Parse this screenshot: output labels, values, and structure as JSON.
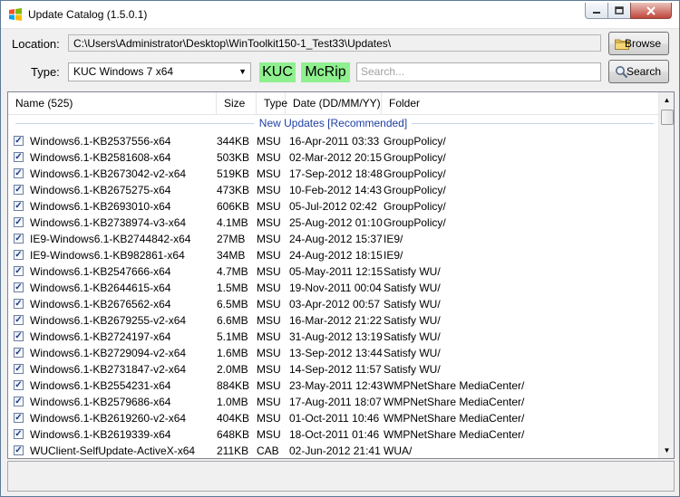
{
  "window": {
    "title": "Update Catalog (1.5.0.1)"
  },
  "location": {
    "label": "Location:",
    "path": "C:\\Users\\Administrator\\Desktop\\WinToolkit150-1_Test33\\Updates\\"
  },
  "browse_label": "Browse",
  "type": {
    "label": "Type:",
    "selected": "KUC Windows 7 x64"
  },
  "tags": {
    "kuc": "KUC",
    "mcrip": "McRip"
  },
  "search": {
    "placeholder": "Search...",
    "button_label": "Search"
  },
  "table": {
    "columns": [
      "Name (525)",
      "Size",
      "Type",
      "Date (DD/MM/YY)",
      "Folder"
    ],
    "group_title": "New Updates [Recommended]",
    "rows": [
      {
        "name": "Windows6.1-KB2537556-x64",
        "size": "344KB",
        "type": "MSU",
        "date": "16-Apr-2011 03:33",
        "folder": "GroupPolicy/"
      },
      {
        "name": "Windows6.1-KB2581608-x64",
        "size": "503KB",
        "type": "MSU",
        "date": "02-Mar-2012 20:15",
        "folder": "GroupPolicy/"
      },
      {
        "name": "Windows6.1-KB2673042-v2-x64",
        "size": "519KB",
        "type": "MSU",
        "date": "17-Sep-2012 18:48",
        "folder": "GroupPolicy/"
      },
      {
        "name": "Windows6.1-KB2675275-x64",
        "size": "473KB",
        "type": "MSU",
        "date": "10-Feb-2012 14:43",
        "folder": "GroupPolicy/"
      },
      {
        "name": "Windows6.1-KB2693010-x64",
        "size": "606KB",
        "type": "MSU",
        "date": "05-Jul-2012 02:42",
        "folder": "GroupPolicy/"
      },
      {
        "name": "Windows6.1-KB2738974-v3-x64",
        "size": "4.1MB",
        "type": "MSU",
        "date": "25-Aug-2012 01:10",
        "folder": "GroupPolicy/"
      },
      {
        "name": "IE9-Windows6.1-KB2744842-x64",
        "size": "27MB",
        "type": "MSU",
        "date": "24-Aug-2012 15:37",
        "folder": "IE9/"
      },
      {
        "name": "IE9-Windows6.1-KB982861-x64",
        "size": "34MB",
        "type": "MSU",
        "date": "24-Aug-2012 18:15",
        "folder": "IE9/"
      },
      {
        "name": "Windows6.1-KB2547666-x64",
        "size": "4.7MB",
        "type": "MSU",
        "date": "05-May-2011 12:15",
        "folder": "Satisfy WU/"
      },
      {
        "name": "Windows6.1-KB2644615-x64",
        "size": "1.5MB",
        "type": "MSU",
        "date": "19-Nov-2011 00:04",
        "folder": "Satisfy WU/"
      },
      {
        "name": "Windows6.1-KB2676562-x64",
        "size": "6.5MB",
        "type": "MSU",
        "date": "03-Apr-2012 00:57",
        "folder": "Satisfy WU/"
      },
      {
        "name": "Windows6.1-KB2679255-v2-x64",
        "size": "6.6MB",
        "type": "MSU",
        "date": "16-Mar-2012 21:22",
        "folder": "Satisfy WU/"
      },
      {
        "name": "Windows6.1-KB2724197-x64",
        "size": "5.1MB",
        "type": "MSU",
        "date": "31-Aug-2012 13:19",
        "folder": "Satisfy WU/"
      },
      {
        "name": "Windows6.1-KB2729094-v2-x64",
        "size": "1.6MB",
        "type": "MSU",
        "date": "13-Sep-2012 13:44",
        "folder": "Satisfy WU/"
      },
      {
        "name": "Windows6.1-KB2731847-v2-x64",
        "size": "2.0MB",
        "type": "MSU",
        "date": "14-Sep-2012 11:57",
        "folder": "Satisfy WU/"
      },
      {
        "name": "Windows6.1-KB2554231-x64",
        "size": "884KB",
        "type": "MSU",
        "date": "23-May-2011 12:43",
        "folder": "WMPNetShare MediaCenter/"
      },
      {
        "name": "Windows6.1-KB2579686-x64",
        "size": "1.0MB",
        "type": "MSU",
        "date": "17-Aug-2011 18:07",
        "folder": "WMPNetShare MediaCenter/"
      },
      {
        "name": "Windows6.1-KB2619260-v2-x64",
        "size": "404KB",
        "type": "MSU",
        "date": "01-Oct-2011 10:46",
        "folder": "WMPNetShare MediaCenter/"
      },
      {
        "name": "Windows6.1-KB2619339-x64",
        "size": "648KB",
        "type": "MSU",
        "date": "18-Oct-2011 01:46",
        "folder": "WMPNetShare MediaCenter/"
      },
      {
        "name": "WUClient-SelfUpdate-ActiveX-x64",
        "size": "211KB",
        "type": "CAB",
        "date": "02-Jun-2012 21:41",
        "folder": "WUA/"
      }
    ]
  },
  "colors": {
    "tag_bg": "#8ff08f",
    "group_text": "#1e3fa5",
    "close_btn": "#c0463b"
  },
  "icons": {
    "app": "windows-flag-icon",
    "browse": "folder-icon",
    "search": "magnifier-icon",
    "check": "checkmark-icon"
  }
}
